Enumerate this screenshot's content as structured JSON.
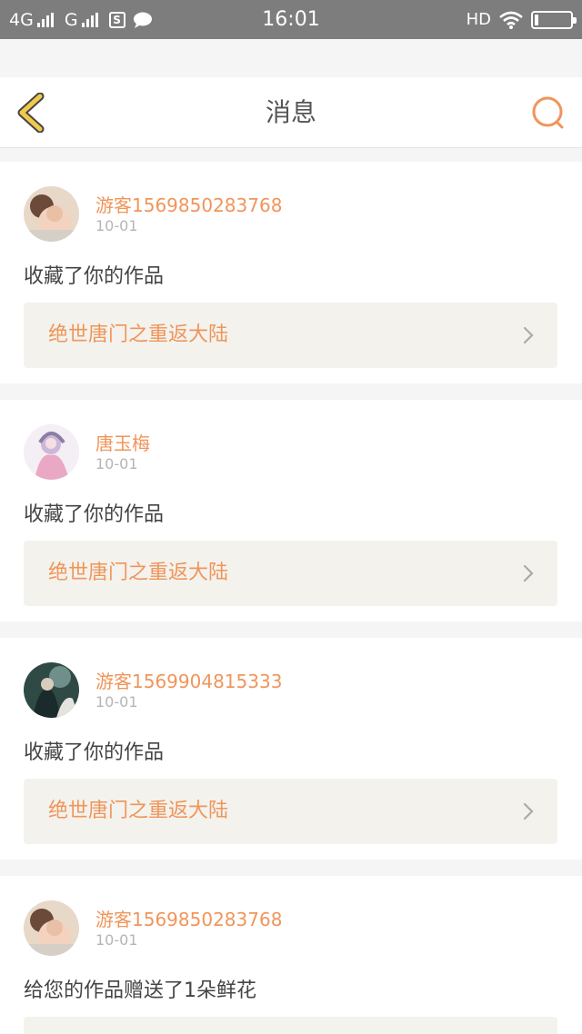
{
  "status_bar": {
    "network1": "4G",
    "network2": "G",
    "sim_icon_label": "S",
    "time": "16:01",
    "hd": "HD"
  },
  "header": {
    "title": "消息"
  },
  "messages": [
    {
      "user": "游客1569850283768",
      "date": "10-01",
      "action": "收藏了你的作品",
      "work_title": "绝世唐门之重返大陆"
    },
    {
      "user": "唐玉梅",
      "date": "10-01",
      "action": "收藏了你的作品",
      "work_title": "绝世唐门之重返大陆"
    },
    {
      "user": "游客1569904815333",
      "date": "10-01",
      "action": "收藏了你的作品",
      "work_title": "绝世唐门之重返大陆"
    },
    {
      "user": "游客1569850283768",
      "date": "10-01",
      "action": "给您的作品赠送了1朵鲜花",
      "work_title": ""
    }
  ],
  "colors": {
    "accent_orange": "#f0955a",
    "back_arrow": "#f2c94c",
    "status_bar": "#7d7d7d",
    "work_bg": "#f3f2ed"
  }
}
